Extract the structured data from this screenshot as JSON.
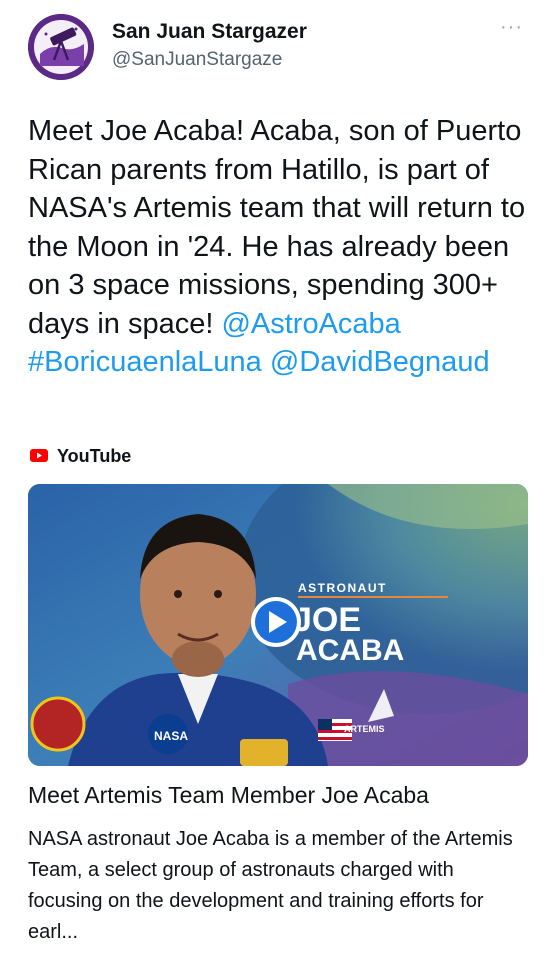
{
  "tweet": {
    "author_name": "San Juan Stargazer",
    "handle": "@SanJuanStargaze",
    "more_glyph": "···",
    "text_prefix": "Meet Joe Acaba! Acaba, son of Puerto Rican parents from Hatillo, is part of NASA's Artemis team that will return to the Moon in '24. He has already been on 3 space missions, spending 300+ days in space! ",
    "mention_1": "@AstroAcaba",
    "hashtag": "#BoricuaenlaLuna",
    "mention_2": "@DavidBegnaud"
  },
  "card": {
    "source_label": "YouTube",
    "thumbnail": {
      "overline": "ASTRONAUT",
      "name_line_1": "JOE",
      "name_line_2": "ACABA",
      "nasa_patch": "NASA",
      "artemis_logo": "ARTEMIS",
      "play_icon": "play-icon"
    },
    "title": "Meet Artemis Team Member Joe Acaba",
    "description": "NASA astronaut Joe Acaba is a member of the Artemis Team, a select group of astronauts charged with focusing on the development and training efforts for earl..."
  },
  "colors": {
    "link": "#1d9bf0",
    "youtube_red": "#ff0000",
    "avatar_purple": "#5b2a86",
    "thumbnail_blue": "#1e4a8a"
  }
}
